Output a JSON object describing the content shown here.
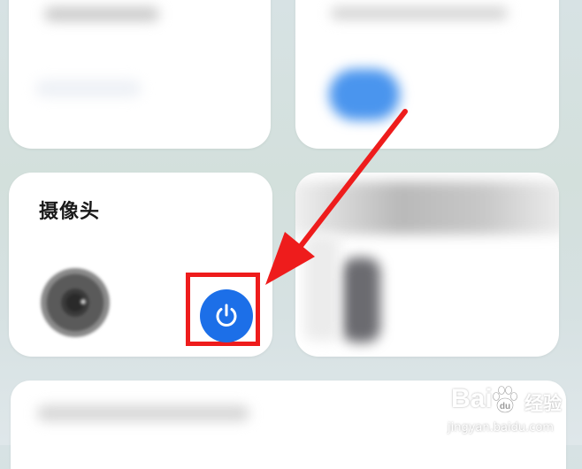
{
  "camera_card": {
    "title": "摄像头",
    "lens_icon": "camera-lens-icon",
    "power_icon": "power-icon",
    "power_button_color": "#1c6fe8"
  },
  "annotation": {
    "highlight_color": "#ee1c1c",
    "arrow_color": "#ee1c1c"
  },
  "watermark": {
    "brand": "Bai",
    "brand_suffix": "经验",
    "url": "jingyan.baidu.com",
    "logo_icon": "baidu-paw-icon"
  }
}
